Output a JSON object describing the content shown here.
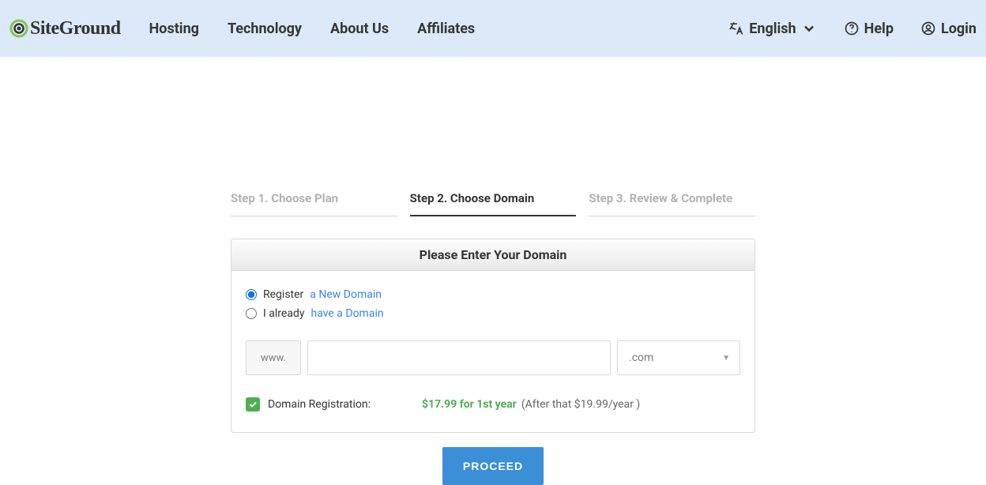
{
  "brand": "SiteGround",
  "nav": {
    "hosting": "Hosting",
    "technology": "Technology",
    "about": "About Us",
    "affiliates": "Affiliates"
  },
  "header_right": {
    "language": "English",
    "help": "Help",
    "login": "Login"
  },
  "steps": {
    "s1": "Step 1. Choose Plan",
    "s2": "Step 2. Choose Domain",
    "s3": "Step 3. Review & Complete"
  },
  "card": {
    "title": "Please Enter Your Domain",
    "register_pre": "Register",
    "register_link": "a New Domain",
    "have_pre": "I already",
    "have_link": "have a Domain",
    "www": "www.",
    "tld": ".com",
    "reg_label": "Domain Registration:",
    "price": "$17.99 for 1st year",
    "after": "(After that $19.99/year )"
  },
  "proceed": "PROCEED"
}
